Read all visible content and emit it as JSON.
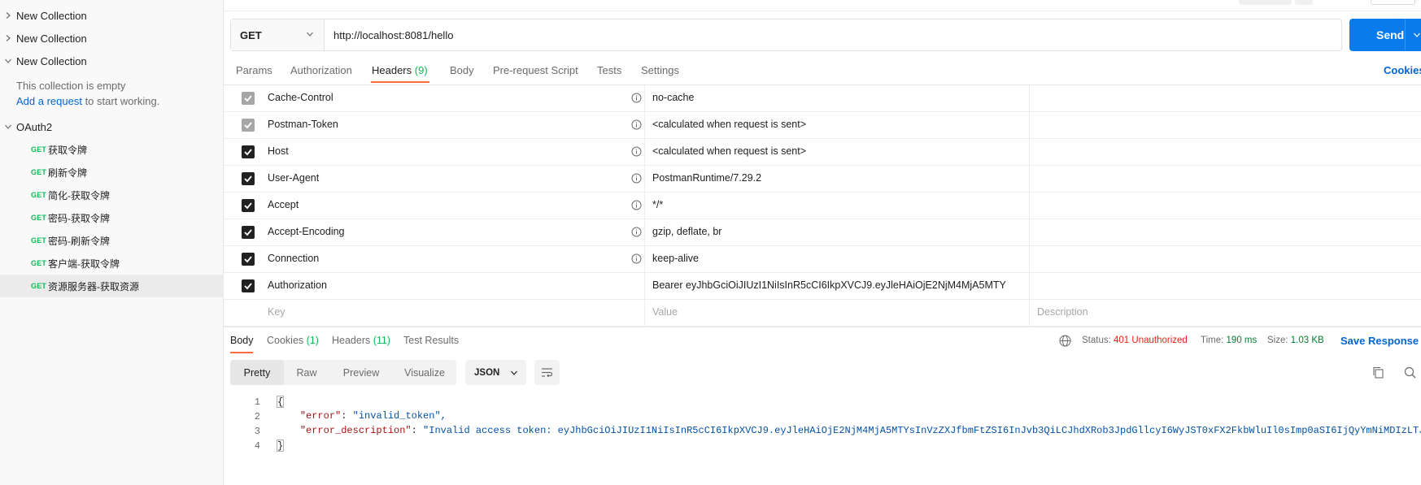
{
  "sidebar": {
    "collections": [
      {
        "name": "New Collection",
        "expanded": false
      },
      {
        "name": "New Collection",
        "expanded": false
      },
      {
        "name": "New Collection",
        "expanded": true
      }
    ],
    "empty_text": "This collection is empty",
    "add_request_link": "Add a request",
    "add_request_suffix": " to start working.",
    "oauth": {
      "name": "OAuth2",
      "requests": [
        {
          "method": "GET",
          "name": "获取令牌"
        },
        {
          "method": "GET",
          "name": "刷新令牌"
        },
        {
          "method": "GET",
          "name": "简化-获取令牌"
        },
        {
          "method": "GET",
          "name": "密码-获取令牌"
        },
        {
          "method": "GET",
          "name": "密码-刷新令牌"
        },
        {
          "method": "GET",
          "name": "客户端-获取令牌"
        },
        {
          "method": "GET",
          "name": "资源服务器-获取资源"
        }
      ]
    }
  },
  "request": {
    "method": "GET",
    "url": "http://localhost:8081/hello",
    "send_label": "Send",
    "tabs": [
      {
        "label": "Params"
      },
      {
        "label": "Authorization"
      },
      {
        "label": "Headers",
        "count": "(9)"
      },
      {
        "label": "Body"
      },
      {
        "label": "Pre-request Script"
      },
      {
        "label": "Tests"
      },
      {
        "label": "Settings"
      }
    ],
    "cookies_label": "Cookies",
    "headers": [
      {
        "key": "Cache-Control",
        "value": "no-cache",
        "checked": true,
        "locked": true
      },
      {
        "key": "Postman-Token",
        "value": "<calculated when request is sent>",
        "checked": true,
        "locked": true
      },
      {
        "key": "Host",
        "value": "<calculated when request is sent>",
        "checked": true,
        "locked": false
      },
      {
        "key": "User-Agent",
        "value": "PostmanRuntime/7.29.2",
        "checked": true,
        "locked": false
      },
      {
        "key": "Accept",
        "value": "*/*",
        "checked": true,
        "locked": false
      },
      {
        "key": "Accept-Encoding",
        "value": "gzip, deflate, br",
        "checked": true,
        "locked": false
      },
      {
        "key": "Connection",
        "value": "keep-alive",
        "checked": true,
        "locked": false
      },
      {
        "key": "Authorization",
        "value": "Bearer eyJhbGciOiJIUzI1NiIsInR5cCI6IkpXVCJ9.eyJleHAiOjE2NjM4MjA5MTY",
        "checked": true,
        "locked": false
      }
    ],
    "new_row": {
      "key_placeholder": "Key",
      "value_placeholder": "Value",
      "description_placeholder": "Description"
    }
  },
  "response": {
    "tabs": [
      {
        "label": "Body"
      },
      {
        "label": "Cookies",
        "count": "(1)"
      },
      {
        "label": "Headers",
        "count": "(11)"
      },
      {
        "label": "Test Results"
      }
    ],
    "status_label": "Status:",
    "status_value": "401 Unauthorized",
    "time_label": "Time:",
    "time_value": "190 ms",
    "size_label": "Size:",
    "size_value": "1.03 KB",
    "save_label": "Save Response",
    "view_modes": [
      "Pretty",
      "Raw",
      "Preview",
      "Visualize"
    ],
    "format": "JSON",
    "body_lines": [
      {
        "n": "1"
      },
      {
        "n": "2",
        "key": "\"error\"",
        "value": "\"invalid_token\","
      },
      {
        "n": "3",
        "key": "\"error_description\"",
        "value": "\"Invalid access token: eyJhbGciOiJIUzI1NiIsInR5cCI6IkpXVCJ9.eyJleHAiOjE2NjM4MjA5MTYsInVzZXJfbmFtZSI6InJvb3QiLCJhdXRob3JpdGllcyI6WyJST0xFX2FkbWluIl0sImp0aSI6IjQyYmNiMDIzLTJ"
      },
      {
        "n": "4"
      }
    ]
  },
  "colors": {
    "accent": "#ff6c37",
    "send": "#097bed",
    "link": "#0265d2",
    "get_method": "#0cbb52",
    "status_error": "#eb2013"
  }
}
